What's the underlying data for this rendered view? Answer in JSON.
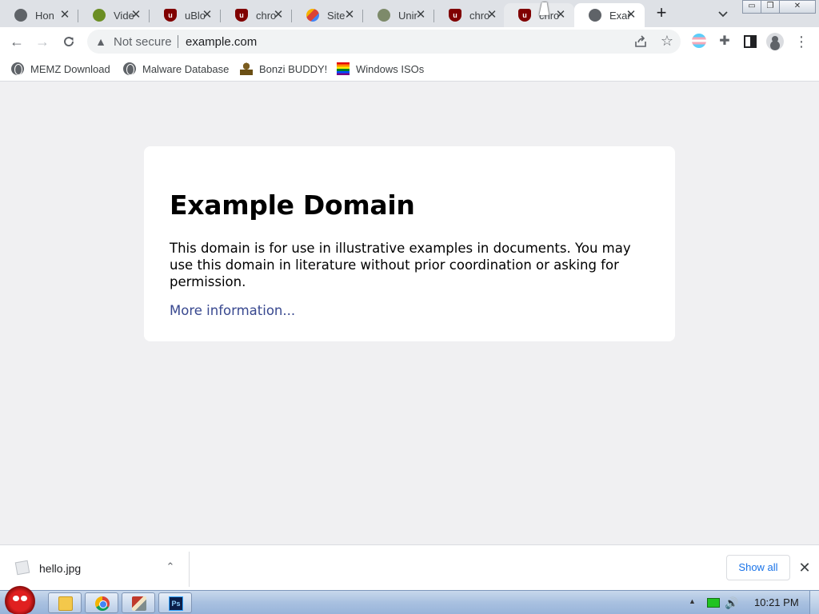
{
  "tabs": [
    {
      "title": "Hon",
      "icon": "globe-icon"
    },
    {
      "title": "Vide",
      "icon": "gear-favicon-icon"
    },
    {
      "title": "uBlo",
      "icon": "ublock-icon"
    },
    {
      "title": "chro",
      "icon": "ublock-icon"
    },
    {
      "title": "Site",
      "icon": "site-favicon-icon"
    },
    {
      "title": "Unir",
      "icon": "unit-favicon-icon"
    },
    {
      "title": "chro",
      "icon": "ublock-icon"
    },
    {
      "title": "chro",
      "icon": "ublock-icon"
    },
    {
      "title": "Exar",
      "icon": "globe-icon",
      "active": true
    }
  ],
  "toolbar": {
    "security_label": "Not secure",
    "url": "example.com"
  },
  "bookmarks": [
    {
      "label": "MEMZ Download",
      "icon": "globe-icon"
    },
    {
      "label": "Malware Database",
      "icon": "globe-icon"
    },
    {
      "label": "Bonzi BUDDY!",
      "icon": "bonzi-icon"
    },
    {
      "label": "Windows ISOs",
      "icon": "rainbow-flag-icon"
    }
  ],
  "page": {
    "heading": "Example Domain",
    "body": "This domain is for use in illustrative examples in documents. You may use this domain in literature without prior coordination or asking for permission.",
    "link": "More information..."
  },
  "downloads": {
    "file_name": "hello.jpg",
    "show_all": "Show all"
  },
  "taskbar": {
    "clock": "10:21 PM"
  },
  "colors": {
    "page_background": "#f0f0f2",
    "link": "#38488f",
    "show_all": "#1a73e8"
  }
}
